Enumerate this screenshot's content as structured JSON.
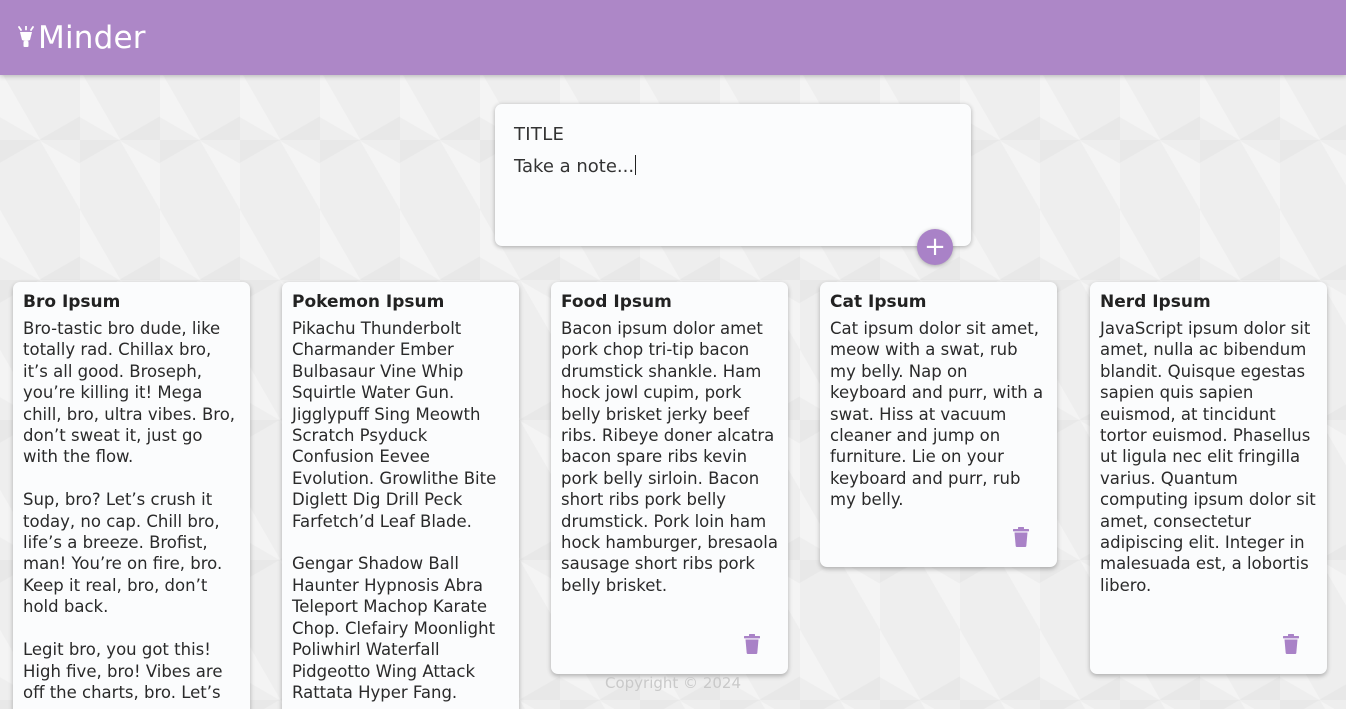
{
  "app": {
    "name": "Minder",
    "logo_icon": "lightbulb-icon",
    "accent": "#ad87c7"
  },
  "create_note": {
    "title_placeholder": "TITLE",
    "body_placeholder": "Take a note...",
    "add_icon": "+"
  },
  "notes": [
    {
      "title": "Bro Ipsum",
      "content": "Bro-tastic bro dude, like totally rad. Chillax bro, it’s all good. Broseph, you’re killing it! Mega chill, bro, ultra vibes. Bro, don’t sweat it, just go with the flow.\n\nSup, bro? Let’s crush it today, no cap. Chill bro, life’s a breeze. Brofist, man! You’re on fire, bro. Keep it real, bro, don’t hold back.\n\nLegit bro, you got this! High five, bro! Vibes are off the charts, bro. Let’s"
    },
    {
      "title": "Pokemon Ipsum",
      "content": "Pikachu Thunderbolt Charmander Ember Bulbasaur Vine Whip Squirtle Water Gun. Jigglypuff Sing Meowth Scratch Psyduck Confusion Eevee Evolution. Growlithe Bite Diglett Dig Drill Peck Farfetch’d Leaf Blade.\n\nGengar Shadow Ball Haunter Hypnosis Abra Teleport Machop Karate Chop. Clefairy Moonlight Poliwhirl Waterfall Pidgeotto Wing Attack Rattata Hyper Fang."
    },
    {
      "title": "Food Ipsum",
      "content": "Bacon ipsum dolor amet pork chop tri-tip bacon drumstick shankle. Ham hock jowl cupim, pork belly brisket jerky beef ribs. Ribeye doner alcatra bacon spare ribs kevin pork belly sirloin. Bacon short ribs pork belly drumstick. Pork loin ham hock hamburger, bresaola sausage short ribs pork belly brisket."
    },
    {
      "title": "Cat Ipsum",
      "content": "Cat ipsum dolor sit amet, meow with a swat, rub my belly. Nap on keyboard and purr, with a swat. Hiss at vacuum cleaner and jump on furniture. Lie on your keyboard and purr, rub my belly."
    },
    {
      "title": "Nerd Ipsum",
      "content": "JavaScript ipsum dolor sit amet, nulla ac bibendum blandit. Quisque egestas sapien quis sapien euismod, at tincidunt tortor euismod. Phasellus ut ligula nec elit fringilla varius. Quantum computing ipsum dolor sit amet, consectetur adipiscing elit. Integer in malesuada est, a lobortis libero."
    }
  ],
  "footer": {
    "text": "Copyright © 2024"
  }
}
